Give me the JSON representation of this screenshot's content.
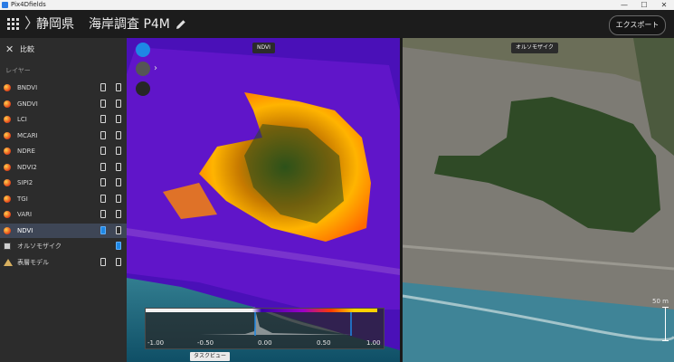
{
  "window": {
    "title": "Pix4Dfields",
    "minimize": "—",
    "maximize": "☐",
    "close": "✕"
  },
  "header": {
    "breadcrumb_separator": "〉",
    "project_region": "静岡県",
    "project_name": "海岸調査 P4M",
    "edit_icon": "pencil-icon",
    "export_label": "エクスポート"
  },
  "sidebar": {
    "close_icon": "✕",
    "compare_label": "比較",
    "layers_heading": "レイヤー",
    "items": [
      {
        "label": "BNDVI",
        "icon": "index-icon",
        "left_state": "off",
        "right_state": "off"
      },
      {
        "label": "GNDVI",
        "icon": "index-icon",
        "left_state": "off",
        "right_state": "off"
      },
      {
        "label": "LCI",
        "icon": "index-icon",
        "left_state": "off",
        "right_state": "off"
      },
      {
        "label": "MCARI",
        "icon": "index-icon",
        "left_state": "off",
        "right_state": "off"
      },
      {
        "label": "NDRE",
        "icon": "index-icon",
        "left_state": "off",
        "right_state": "off"
      },
      {
        "label": "NDVI2",
        "icon": "index-icon",
        "left_state": "off",
        "right_state": "off"
      },
      {
        "label": "SIPI2",
        "icon": "index-icon",
        "left_state": "off",
        "right_state": "off"
      },
      {
        "label": "TGI",
        "icon": "index-icon",
        "left_state": "off",
        "right_state": "off"
      },
      {
        "label": "VARI",
        "icon": "index-icon",
        "left_state": "off",
        "right_state": "off"
      },
      {
        "label": "NDVI",
        "icon": "index-icon",
        "left_state": "on",
        "right_state": "off",
        "selected": true
      },
      {
        "label": "オルソモザイク",
        "icon": "orthomosaic-icon",
        "left_state": "empty",
        "right_state": "on"
      },
      {
        "label": "表層モデル",
        "icon": "surface-model-icon",
        "left_state": "off",
        "right_state": "off"
      }
    ]
  },
  "map": {
    "left_pane_label": "NDVI",
    "right_pane_label": "オルソモザイク",
    "controls": [
      "layers-icon",
      "location-pin-icon",
      "globe-icon"
    ],
    "histogram": {
      "ticks": [
        "-1.00",
        "-0.50",
        "0.00",
        "0.50",
        "1.00"
      ],
      "tooltip": "タスクビュー"
    },
    "scale_bar": "50 m"
  },
  "colors": {
    "accent": "#1e88e5",
    "selected_row": "#3e4656",
    "ndvi_low": "#3a00a8",
    "ndvi_high": "#ffd200"
  }
}
